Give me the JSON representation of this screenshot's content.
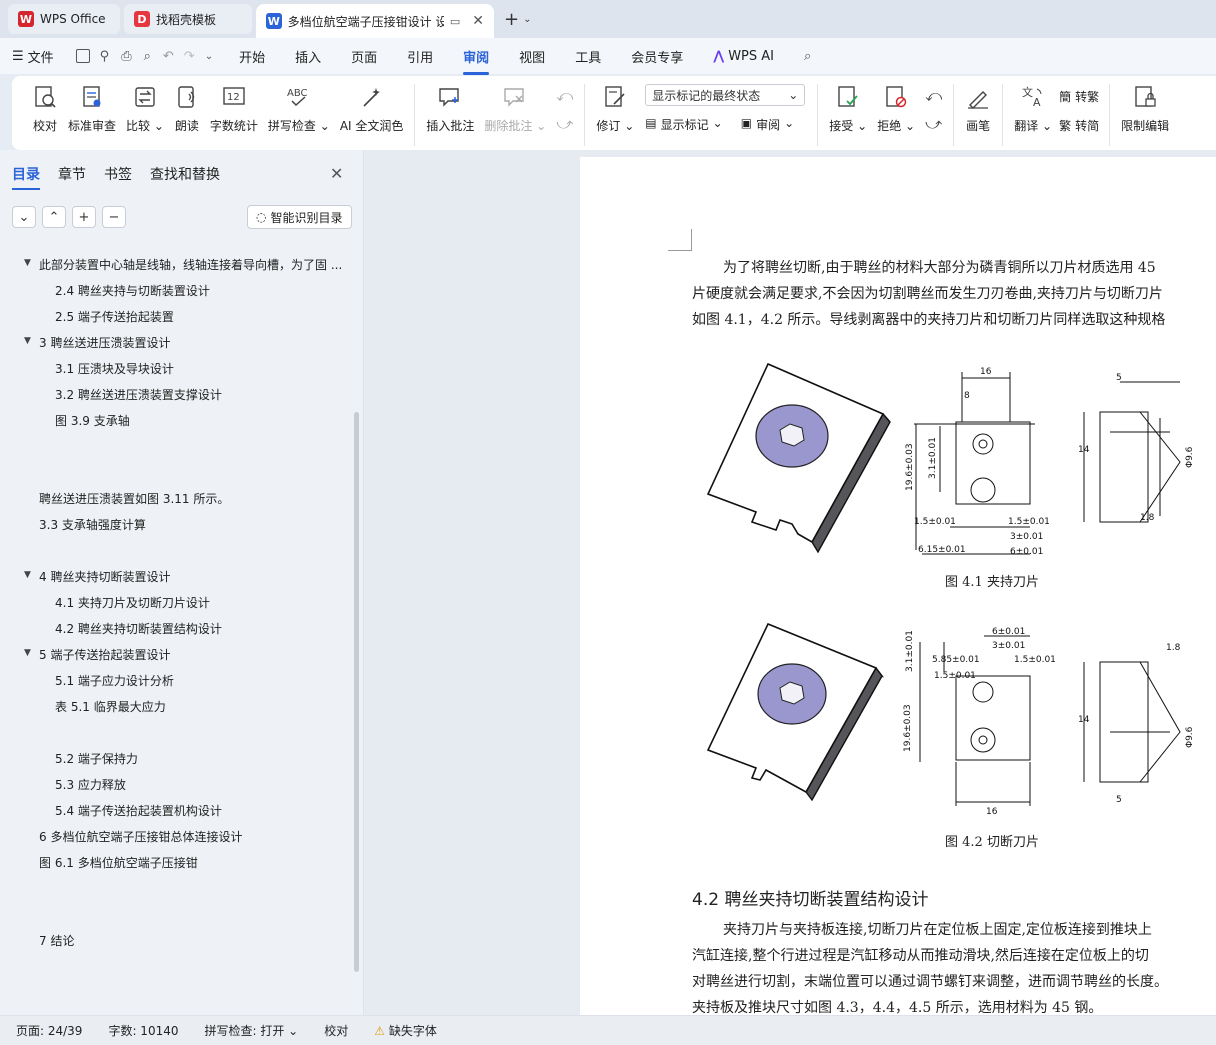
{
  "tabs": [
    {
      "label": "WPS Office",
      "logo": "W",
      "color": "#d6262d"
    },
    {
      "label": "找稻壳模板",
      "logo": "D",
      "color": "#e5373f"
    },
    {
      "label": "多档位航空端子压接钳设计 设",
      "logo": "W",
      "color": "#2b63d9"
    }
  ],
  "menubar": {
    "file": "文件",
    "items": [
      "开始",
      "插入",
      "页面",
      "引用",
      "审阅",
      "视图",
      "工具",
      "会员专享"
    ],
    "selected": "审阅",
    "ai": "WPS AI"
  },
  "ribbon": {
    "proofread": "校对",
    "standard_review": "标准审查",
    "compare": "比较",
    "read_aloud": "朗读",
    "word_count": "字数统计",
    "spell_check": "拼写检查",
    "ai_polish": "AI 全文润色",
    "insert_comment": "插入批注",
    "delete_comment": "删除批注",
    "track": "修订",
    "show_final_combo": "显示标记的最终状态",
    "show_markup": "显示标记",
    "review": "审阅",
    "accept": "接受",
    "reject": "拒绝",
    "pen": "画笔",
    "translate": "翻译",
    "to_traditional": "转繁",
    "to_simplified": "转简",
    "restrict_edit": "限制编辑"
  },
  "nav": {
    "tabs": [
      "目录",
      "章节",
      "书签",
      "查找和替换"
    ],
    "smart_btn": "智能识别目录",
    "toc": [
      "此部分装置中心轴是线轴，线轴连接着导向槽，为了固 ...",
      "2.4    聘丝夹持与切断装置设计",
      "2.5    端子传送抬起装置",
      "3    聘丝送进压溃装置设计",
      "3.1    压溃块及导块设计",
      "3.2    聘丝送进压溃装置支撑设计",
      "图 3.9    支承轴",
      "聘丝送进压溃装置如图 3.11 所示。",
      "3.3    支承轴强度计算",
      "4    聘丝夹持切断装置设计",
      "4.1    夹持刀片及切断刀片设计",
      "4.2    聘丝夹持切断装置结构设计",
      "5    端子传送抬起装置设计",
      "5.1    端子应力设计分析",
      "表 5.1 临界最大应力",
      "5.2    端子保持力",
      "5.3    应力释放",
      "5.4    端子传送抬起装置机构设计",
      "6    多档位航空端子压接钳总体连接设计",
      "图 6.1    多档位航空端子压接钳",
      "7    结论"
    ]
  },
  "doc": {
    "para1": [
      "为了将聘丝切断,由于聘丝的材料大部分为磷青铜所以刀片材质选用 45 ",
      "片硬度就会满足要求,不会因为切割聘丝而发生刀刃卷曲,夹持刀片与切断刀片",
      "如图 4.1，4.2 所示。导线剥离器中的夹持刀片和切断刀片同样选取这种规格"
    ],
    "fig1_caption": "图 4.1    夹持刀片",
    "fig2_caption": "图 4.2    切断刀片",
    "heading": "4.2    聘丝夹持切断装置结构设计",
    "para2": [
      "夹持刀片与夹持板连接,切断刀片在定位板上固定,定位板连接到推块上",
      "汽缸连接,整个行进过程是汽缸移动从而推动滑块,然后连接在定位板上的切",
      "对聘丝进行切割，末端位置可以通过调节螺钉来调整，进而调节聘丝的长度。",
      "夹持板及推块尺寸如图 4.3，4.4，4.5 所示，选用材料为 45 钢。"
    ],
    "dims1": [
      "16",
      "8",
      "19.6±0.03",
      "3.1±0.01",
      "1.5±0.01",
      "6.15±0.01",
      "1.5±0.01",
      "3±0.01",
      "6±0.01",
      "14",
      "5",
      "1.8",
      "Φ9.6"
    ],
    "dims2": [
      "6±0.01",
      "3±0.01",
      "5.85±0.01",
      "1.5±0.01",
      "1.5±0.01",
      "3.1±0.01",
      "19.6±0.03",
      "16",
      "14",
      "1.8",
      "5",
      "Φ9.6"
    ]
  },
  "status": {
    "page": "页面: 24/39",
    "words": "字数: 10140",
    "spell": "拼写检查: 打开",
    "proof": "校对",
    "missing_font": "缺失字体"
  }
}
